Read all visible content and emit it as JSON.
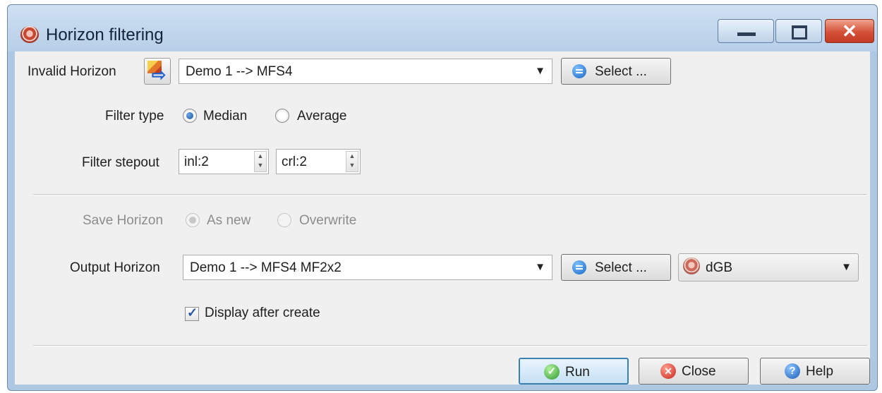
{
  "window": {
    "title": "Horizon filtering",
    "controls": {
      "minimize": "minimize",
      "maximize": "maximize",
      "close": "✕"
    }
  },
  "input": {
    "label": "Invalid Horizon",
    "icon": "horizon-transfer-icon",
    "value": "Demo 1 --> MFS4",
    "select_label": "Select ..."
  },
  "filter_type": {
    "label": "Filter type",
    "options": [
      {
        "label": "Median",
        "checked": true
      },
      {
        "label": "Average",
        "checked": false
      }
    ]
  },
  "stepout": {
    "label": "Filter stepout",
    "inl": "inl:2",
    "crl": "crl:2"
  },
  "save": {
    "label": "Save Horizon",
    "disabled": true,
    "options": [
      {
        "label": "As new",
        "checked": true
      },
      {
        "label": "Overwrite",
        "checked": false
      }
    ]
  },
  "output": {
    "label": "Output Horizon",
    "value": "Demo 1 --> MFS4 MF2x2",
    "select_label": "Select ...",
    "storage": "dGB"
  },
  "display_after_create": {
    "label": "Display after create",
    "checked": true
  },
  "buttons": {
    "run": "Run",
    "close": "Close",
    "help": "Help"
  },
  "colors": {
    "title_bar": "#b7cfe8",
    "client_bg": "#f0f0f0",
    "default_button_border": "#3c7fb1"
  }
}
